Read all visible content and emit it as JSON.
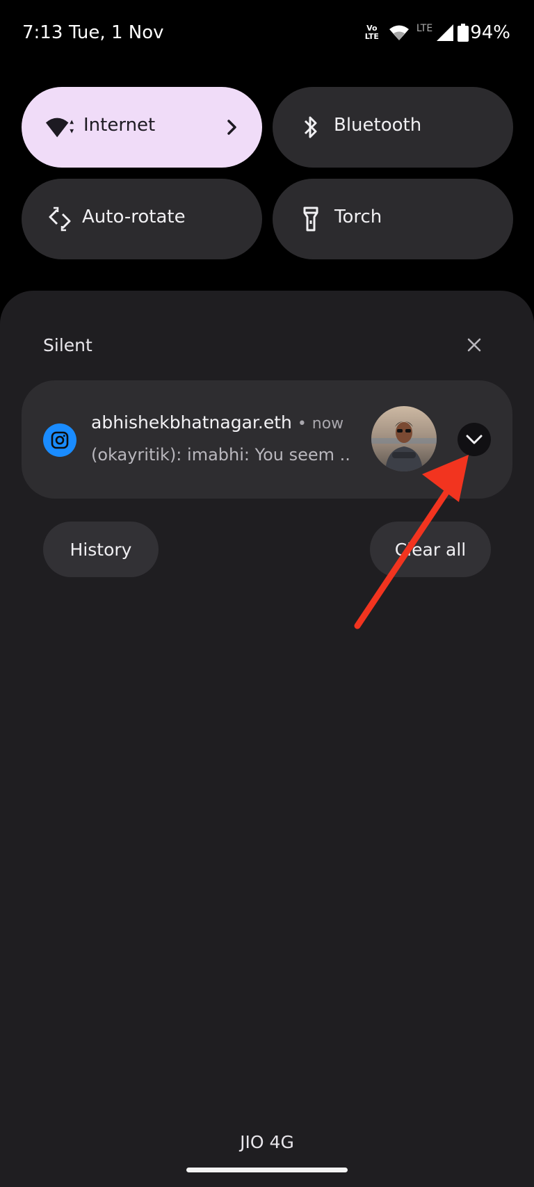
{
  "status_bar": {
    "time": "7:13",
    "date": "Tue, 1 Nov",
    "volte_top": "Vo",
    "volte_bottom": "LTE",
    "network_type": "LTE",
    "battery_percent": "94%",
    "battery_level": 0.94
  },
  "quick_settings": {
    "tiles": [
      {
        "label": "Internet",
        "icon": "wifi-icon",
        "active": true
      },
      {
        "label": "Bluetooth",
        "icon": "bluetooth-icon",
        "active": false
      },
      {
        "label": "Auto-rotate",
        "icon": "auto-rotate-icon",
        "active": false
      },
      {
        "label": "Torch",
        "icon": "torch-icon",
        "active": false
      }
    ]
  },
  "notifications": {
    "section_label": "Silent",
    "items": [
      {
        "app_icon": "instagram-icon",
        "app_color": "#1a8cff",
        "title": "abhishekbhatnagar.eth",
        "separator": "•",
        "time": "now",
        "body": "(okayritik): imabhi: You seem .."
      }
    ],
    "history_label": "History",
    "clear_all_label": "Clear all"
  },
  "annotation": {
    "color": "#f2341f",
    "icon": "red-arrow-pointer"
  },
  "carrier": "JIO 4G",
  "colors": {
    "background": "#000000",
    "shade": "#1f1e21",
    "active_tile": "#f0dcf8",
    "inactive_tile": "#2c2b2e"
  }
}
